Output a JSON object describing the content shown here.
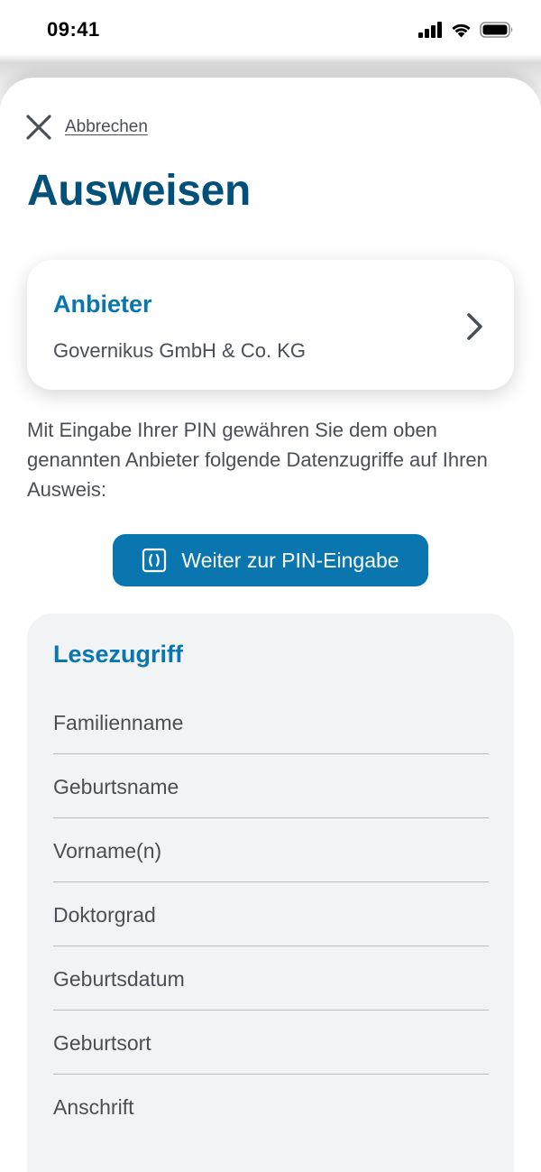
{
  "status_bar": {
    "time": "09:41",
    "icons": [
      "cellular-signal-icon",
      "wifi-icon",
      "battery-icon"
    ]
  },
  "header": {
    "cancel_label": "Abbrechen",
    "title": "Ausweisen"
  },
  "provider": {
    "heading": "Anbieter",
    "name": "Governikus GmbH & Co. KG"
  },
  "description": "Mit Eingabe Ihrer PIN gewähren Sie dem oben genannten Anbieter folgende Datenzugriffe auf Ihren Ausweis:",
  "pin_button": {
    "label": "Weiter zur PIN-Eingabe",
    "icon": "id-card-icon"
  },
  "read_access": {
    "heading": "Lesezugriff",
    "fields": [
      "Familienname",
      "Geburtsname",
      "Vorname(n)",
      "Doktorgrad",
      "Geburtsdatum",
      "Geburtsort",
      "Anschrift"
    ]
  },
  "colors": {
    "title": "#00507a",
    "accent": "#0a76b0",
    "text": "#4a4f55",
    "card_background": "#f1f3f4"
  }
}
